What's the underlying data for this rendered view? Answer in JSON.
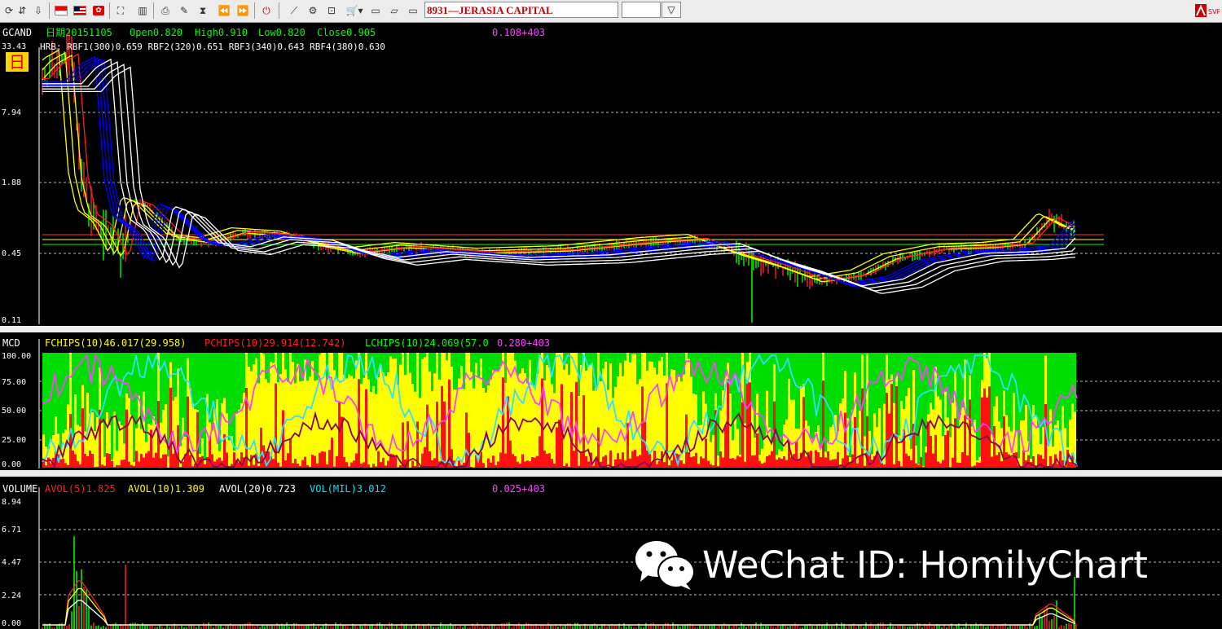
{
  "toolbar": {
    "symbol": "8931—JERASIA CAPITAL",
    "buttons": [
      "refresh-icon",
      "download-icon",
      "flag-sg-icon",
      "flag-my-icon",
      "flag-hk-icon",
      "network-icon",
      "bar-chart-icon",
      "print-icon",
      "edit-icon",
      "hourglass-icon",
      "rewind-icon",
      "fast-forward-icon",
      "power-icon",
      "chart-tool-icon",
      "settings-icon",
      "zoom-icon",
      "cart-icon",
      "folder-icon",
      "folder-open-icon",
      "monitor-icon"
    ]
  },
  "price_panel": {
    "code": "GCAND",
    "date": "日期20151105",
    "open": "Open0.820",
    "high": "High0.910",
    "low": "Low0.820",
    "close": "Close0.905",
    "counter": "0.108+403",
    "hrb": "HRB: RBF1(300)0.659  RBF2(320)0.651  RBF3(340)0.643  RBF4(380)0.630",
    "period_badge": "日",
    "y_labels": [
      "33.43",
      "7.94",
      "1.88",
      "0.45",
      "0.11"
    ],
    "colors": {
      "open": "#00ff00",
      "high": "#00ff00",
      "low": "#00ff00",
      "close": "#00ff00",
      "counter": "#ff40ff",
      "code": "#ffffff",
      "hrb": "#ffffff"
    }
  },
  "mcd_panel": {
    "code": "MCD",
    "fchips": "FCHIPS(10)46.017(29.958)",
    "pchips": "PCHIPS(10)29.914(12.742)",
    "lchips": "LCHIPS(10)24.069(57.0",
    "counter": "0.280+403",
    "y_labels": [
      "100.00",
      "75.00",
      "50.00",
      "25.00",
      "0.00"
    ],
    "colors": {
      "fchips": "#ffff00",
      "pchips": "#ff2020",
      "lchips": "#00ff00",
      "counter": "#ff40ff"
    }
  },
  "volume_panel": {
    "code": "VOLUME",
    "avol5": "AVOL(5)1.825",
    "avol10": "AVOL(10)1.309",
    "avol20": "AVOL(20)0.723",
    "vol": "VOL(MIL)3.012",
    "counter": "0.025+403",
    "y_labels": [
      "8.94",
      "6.71",
      "4.47",
      "2.24",
      "0.00"
    ],
    "colors": {
      "avol5": "#ff2020",
      "avol10": "#ffff00",
      "avol20": "#ffffff",
      "vol": "#00e5ff",
      "counter": "#ff40ff"
    }
  },
  "watermark": {
    "text": "WeChat ID: HomilyChart",
    "icon": "wechat-icon"
  }
}
